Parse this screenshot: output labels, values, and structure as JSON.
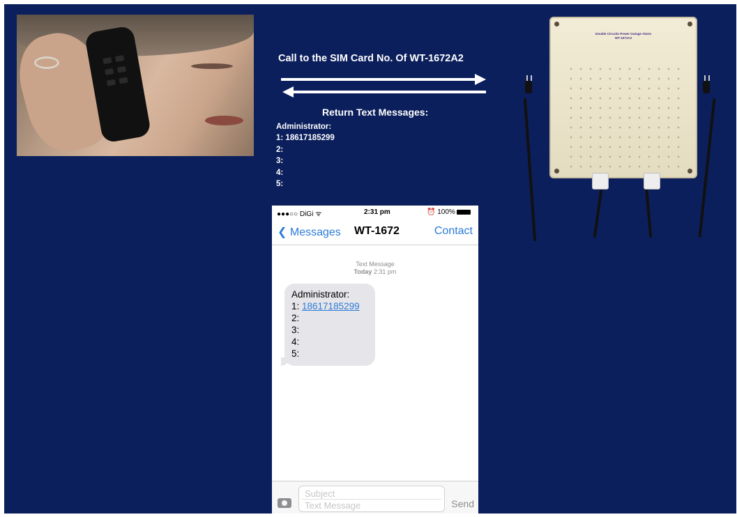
{
  "call_text": "Call to the SIM Card No. Of WT-1672A2",
  "return": {
    "title": "Return Text Messages:",
    "lines": [
      "Administrator:",
      "1: 18617185299",
      "2:",
      "3:",
      "4:",
      "5:"
    ]
  },
  "device": {
    "label_line1": "Double Circuits Power Outage Alarm",
    "label_line2": "WT-1672A2"
  },
  "phone": {
    "carrier": "●●●○○ DiGi ᯤ",
    "time": "2:31 pm",
    "battery": "100%",
    "back_label": "Messages",
    "contact_title": "WT-1672",
    "contact_button": "Contact",
    "meta_line1": "Text Message",
    "meta_line2_bold": "Today",
    "meta_line2_time": "2:31 pm",
    "bubble": {
      "line0": "Administrator:",
      "line1_prefix": "1: ",
      "line1_number": "18617185299",
      "line2": "2:",
      "line3": "3:",
      "line4": "4:",
      "line5": "5:"
    },
    "subject_placeholder": "Subject",
    "message_placeholder": "Text Message",
    "send_label": "Send"
  },
  "colors": {
    "background": "#0b1f5c",
    "ios_blue": "#2b7bd6",
    "bubble_gray": "#e5e5ea"
  }
}
